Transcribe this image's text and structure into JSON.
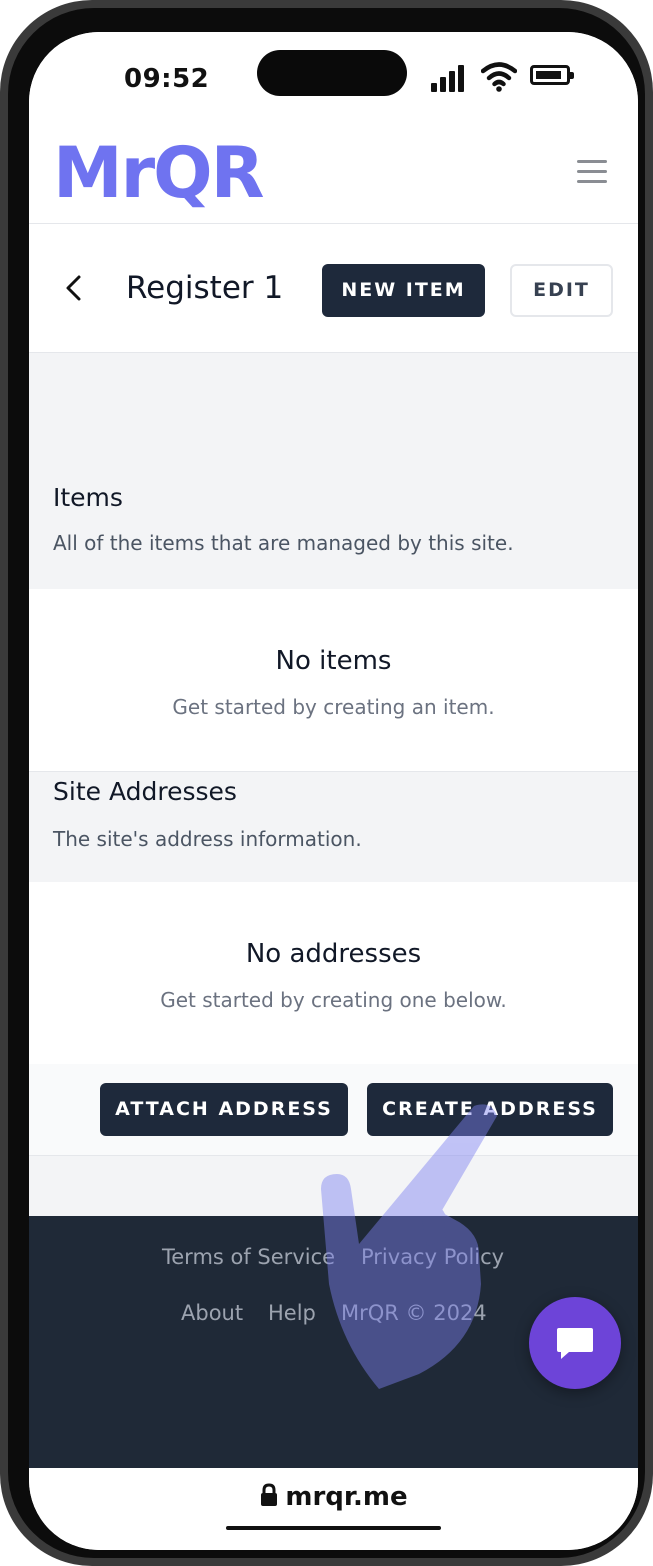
{
  "status_bar": {
    "time": "09:52"
  },
  "header": {
    "logo": "MrQR",
    "menu_icon": "hamburger-menu-icon"
  },
  "titlebar": {
    "title": "Register 1",
    "new_item_label": "NEW ITEM",
    "edit_label": "EDIT",
    "back_icon": "chevron-left-icon"
  },
  "items_section": {
    "title": "Items",
    "subtitle": "All of the items that are managed by this site.",
    "empty_title": "No items",
    "empty_subtitle": "Get started by creating an item."
  },
  "addresses_section": {
    "title": "Site Addresses",
    "subtitle": "The site's address information.",
    "empty_title": "No addresses",
    "empty_subtitle": "Get started by creating one below.",
    "attach_label": "ATTACH ADDRESS",
    "create_label": "CREATE ADDRESS"
  },
  "footer": {
    "links_row1": [
      "Terms of Service",
      "Privacy Policy"
    ],
    "links_row2": [
      "About",
      "Help"
    ],
    "copyright": "MrQR © 2024"
  },
  "browser": {
    "url": "mrqr.me",
    "lock_icon": "lock-icon"
  },
  "colors": {
    "brand": "#6f73f0",
    "dark": "#1e293b",
    "footer": "#1f2937",
    "chat": "#6d44d8",
    "pointer": "#7c80f0"
  }
}
